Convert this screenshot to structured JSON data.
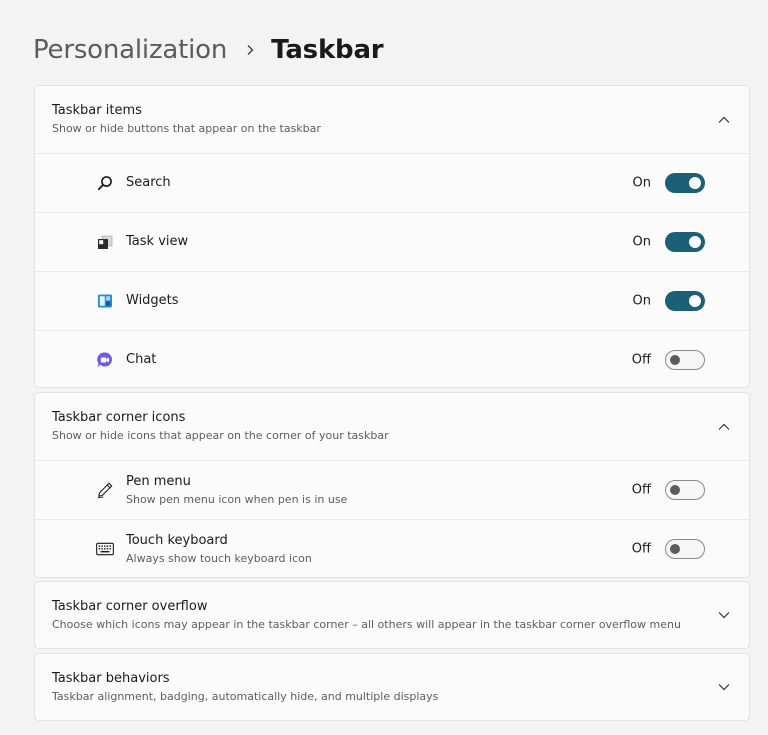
{
  "breadcrumb": {
    "parent": "Personalization",
    "current": "Taskbar"
  },
  "sections": {
    "taskbar_items": {
      "title": "Taskbar items",
      "subtitle": "Show or hide buttons that appear on the taskbar",
      "items": [
        {
          "label": "Search",
          "state": "On",
          "icon": "search-icon"
        },
        {
          "label": "Task view",
          "state": "On",
          "icon": "task-view-icon"
        },
        {
          "label": "Widgets",
          "state": "On",
          "icon": "widgets-icon"
        },
        {
          "label": "Chat",
          "state": "Off",
          "icon": "chat-icon"
        }
      ]
    },
    "corner_icons": {
      "title": "Taskbar corner icons",
      "subtitle": "Show or hide icons that appear on the corner of your taskbar",
      "items": [
        {
          "label": "Pen menu",
          "description": "Show pen menu icon when pen is in use",
          "state": "Off",
          "icon": "pen-icon"
        },
        {
          "label": "Touch keyboard",
          "description": "Always show touch keyboard icon",
          "state": "Off",
          "icon": "keyboard-icon"
        }
      ]
    },
    "corner_overflow": {
      "title": "Taskbar corner overflow",
      "subtitle": "Choose which icons may appear in the taskbar corner – all others will appear in the taskbar corner overflow menu"
    },
    "behaviors": {
      "title": "Taskbar behaviors",
      "subtitle": "Taskbar alignment, badging, automatically hide, and multiple displays"
    }
  },
  "colors": {
    "accent": "#1b6077",
    "background": "#f3f3f3",
    "card": "#fbfbfb"
  }
}
